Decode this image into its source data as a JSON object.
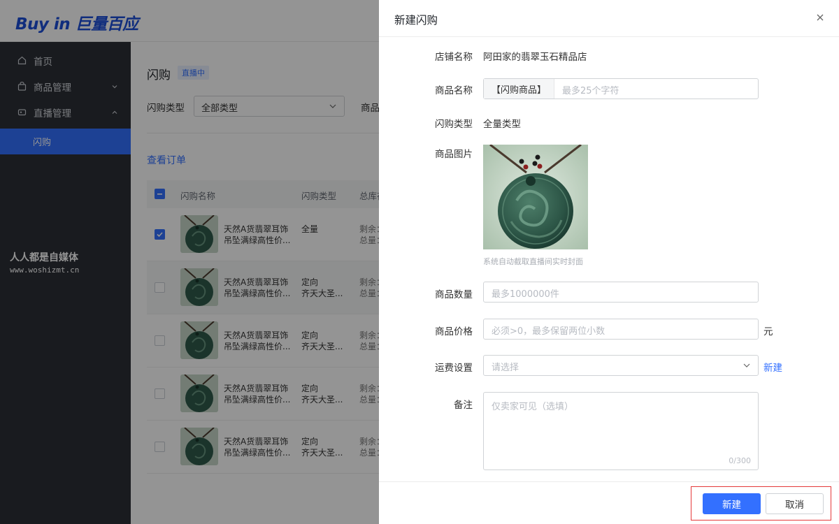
{
  "brand": {
    "logo": "Buy in 巨量百应"
  },
  "sidebar": {
    "items": [
      {
        "label": "首页",
        "icon": "home-icon"
      },
      {
        "label": "商品管理",
        "icon": "bag-icon"
      },
      {
        "label": "直播管理",
        "icon": "live-icon"
      }
    ],
    "active_sub": "闪购"
  },
  "watermark": {
    "line1": "人人都是自媒体",
    "line2": "www.woshizmt.cn"
  },
  "page": {
    "title": "闪购",
    "status_tag": "直播中",
    "filter_label": "闪购类型",
    "filter_value": "全部类型",
    "filter2_label": "商品",
    "view_orders": "查看订单",
    "table": {
      "headers": [
        "闪购名称",
        "闪购类型",
        "总库存"
      ],
      "rows": [
        {
          "name": "天然A货翡翠耳饰吊坠满绿高性价...",
          "type_line1": "全量",
          "type_line2": "",
          "stock1": "剩余：",
          "stock2": "总量：",
          "checked": true,
          "highlight": false
        },
        {
          "name": "天然A货翡翠耳饰吊坠满绿高性价...",
          "type_line1": "定向",
          "type_line2": "齐天大圣...",
          "stock1": "剩余：",
          "stock2": "总量：",
          "checked": false,
          "highlight": true
        },
        {
          "name": "天然A货翡翠耳饰吊坠满绿高性价...",
          "type_line1": "定向",
          "type_line2": "齐天大圣...",
          "stock1": "剩余：",
          "stock2": "总量：",
          "checked": false,
          "highlight": false
        },
        {
          "name": "天然A货翡翠耳饰吊坠满绿高性价...",
          "type_line1": "定向",
          "type_line2": "齐天大圣...",
          "stock1": "剩余：",
          "stock2": "总量：",
          "checked": false,
          "highlight": false
        },
        {
          "name": "天然A货翡翠耳饰吊坠满绿高性价...",
          "type_line1": "定向",
          "type_line2": "齐天大圣...",
          "stock1": "剩余：",
          "stock2": "总量：",
          "checked": false,
          "highlight": false
        }
      ]
    }
  },
  "drawer": {
    "title": "新建闪购",
    "fields": {
      "shop_name": {
        "label": "店铺名称",
        "value": "阿田家的翡翠玉石精品店"
      },
      "product_name": {
        "label": "商品名称",
        "prefix": "【闪购商品】",
        "placeholder": "最多25个字符"
      },
      "flash_type": {
        "label": "闪购类型",
        "value": "全量类型"
      },
      "product_image": {
        "label": "商品图片",
        "hint": "系统自动截取直播间实时封面"
      },
      "quantity": {
        "label": "商品数量",
        "placeholder": "最多1000000件"
      },
      "price": {
        "label": "商品价格",
        "placeholder": "必须>0，最多保留两位小数",
        "unit": "元"
      },
      "shipping": {
        "label": "运费设置",
        "placeholder": "请选择",
        "link": "新建"
      },
      "remark": {
        "label": "备注",
        "placeholder": "仅卖家可见（选填）",
        "counter": "0/300"
      }
    },
    "footer": {
      "submit": "新建",
      "cancel": "取消"
    }
  },
  "colors": {
    "primary": "#3370ff",
    "highlight_border": "#e5393a",
    "sidebar_bg": "#2b2f36"
  }
}
